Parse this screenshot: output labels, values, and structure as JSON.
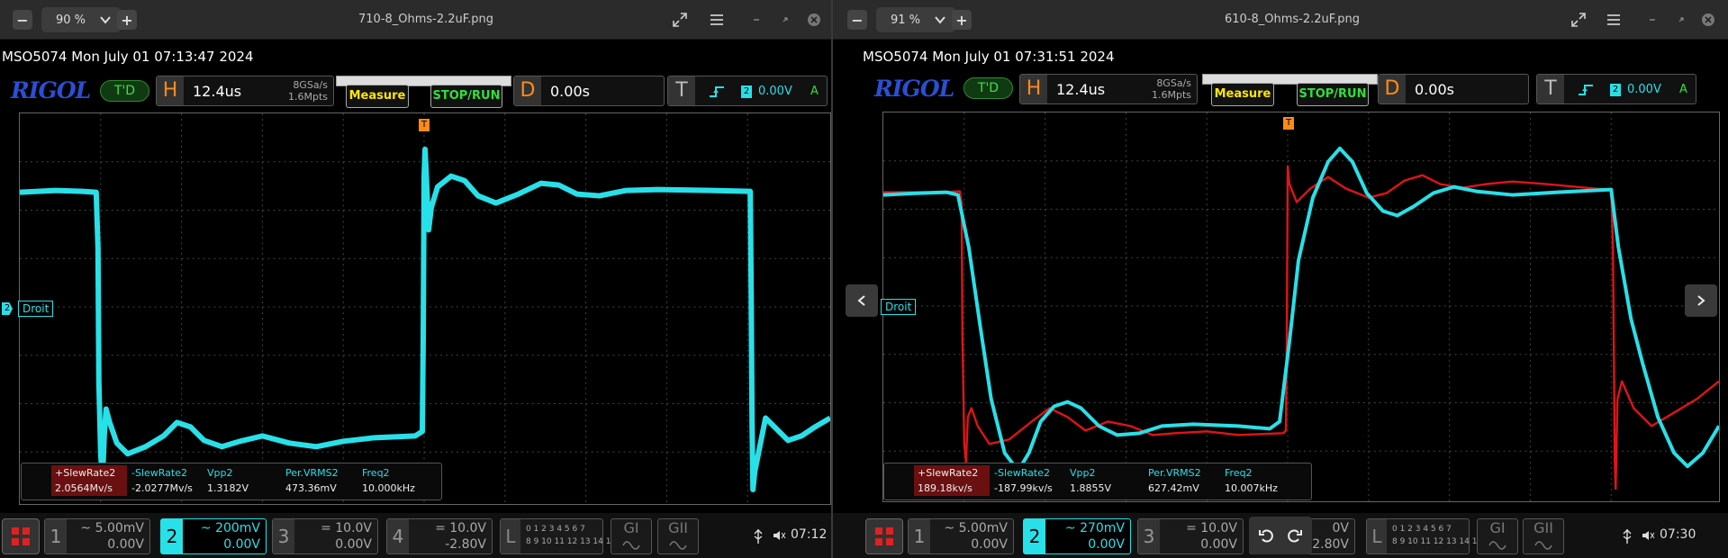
{
  "left": {
    "zoom": "90 %",
    "filename": "710-8_Ohms-2.2uF.png",
    "status": "MSO5074   Mon July 01 07:13:47 2024",
    "logo": "RIGOL",
    "td": "T'D",
    "h_label": "H",
    "h_value": "12.4us",
    "h_rate": "8GSa/s",
    "h_pts": "1.6Mpts",
    "measure": "Measure",
    "stoprun": "STOP/RUN",
    "d_label": "D",
    "d_value": "0.00s",
    "t_label": "T",
    "t_ch": "2",
    "t_value": "0.00V",
    "t_mode": "A",
    "marker_ch": "2",
    "marker_label": "Droit",
    "trig_mark": "T",
    "measurements": [
      {
        "label": "+SlewRate2",
        "value": "2.0564Mv/s"
      },
      {
        "label": "-SlewRate2",
        "value": "-2.0277Mv/s"
      },
      {
        "label": "Vpp2",
        "value": "1.3182V"
      },
      {
        "label": "Per.VRMS2",
        "value": "473.36mV"
      },
      {
        "label": "Freq2",
        "value": "10.000kHz"
      }
    ],
    "channels": [
      {
        "num": "1",
        "scale": "5.00mV",
        "offset": "0.00V",
        "coupling": "~"
      },
      {
        "num": "2",
        "scale": "200mV",
        "offset": "0.00V",
        "coupling": "~"
      },
      {
        "num": "3",
        "scale": "10.0V",
        "offset": "0.00V",
        "coupling": "="
      },
      {
        "num": "4",
        "scale": "10.0V",
        "offset": "-2.80V",
        "coupling": "="
      }
    ],
    "logic": {
      "label": "L",
      "row1": "0 1 2 3  4 5 6 7",
      "row2": "8 9 10 11 12 13 14 15"
    },
    "g1": "GI",
    "g2": "GII",
    "time": "07:12",
    "usb": "↧",
    "vol": "⊙"
  },
  "right": {
    "zoom": "91 %",
    "filename": "610-8_Ohms-2.2uF.png",
    "status": "MSO5074   Mon July 01 07:31:51 2024",
    "logo": "RIGOL",
    "td": "T'D",
    "h_label": "H",
    "h_value": "12.4us",
    "h_rate": "8GSa/s",
    "h_pts": "1.6Mpts",
    "measure": "Measure",
    "stoprun": "STOP/RUN",
    "d_label": "D",
    "d_value": "0.00s",
    "t_label": "T",
    "t_ch": "2",
    "t_value": "0.00V",
    "t_mode": "A",
    "marker_label": "Droit",
    "trig_mark": "T",
    "measurements": [
      {
        "label": "+SlewRate2",
        "value": "189.18kv/s"
      },
      {
        "label": "-SlewRate2",
        "value": "-187.99kv/s"
      },
      {
        "label": "Vpp2",
        "value": "1.8855V"
      },
      {
        "label": "Per.VRMS2",
        "value": "627.42mV"
      },
      {
        "label": "Freq2",
        "value": "10.007kHz"
      }
    ],
    "channels": [
      {
        "num": "1",
        "scale": "5.00mV",
        "offset": "0.00V",
        "coupling": "~"
      },
      {
        "num": "2",
        "scale": "270mV",
        "offset": "0.00V",
        "coupling": "~"
      },
      {
        "num": "3",
        "scale": "10.0V",
        "offset": "0.00V",
        "coupling": "="
      }
    ],
    "ch4_partial": {
      "scale": "0V",
      "offset": "-2.80V"
    },
    "logic": {
      "label": "L",
      "row1": "0 1 2 3  4 5 6 7",
      "row2": "8 9 10 11 12 13 14 15"
    },
    "g1": "GI",
    "g2": "GII",
    "time": "07:30"
  },
  "colors": {
    "ch2": "#28e0e8",
    "ch_red": "#e01414",
    "trigger": "#ff8a1a"
  }
}
